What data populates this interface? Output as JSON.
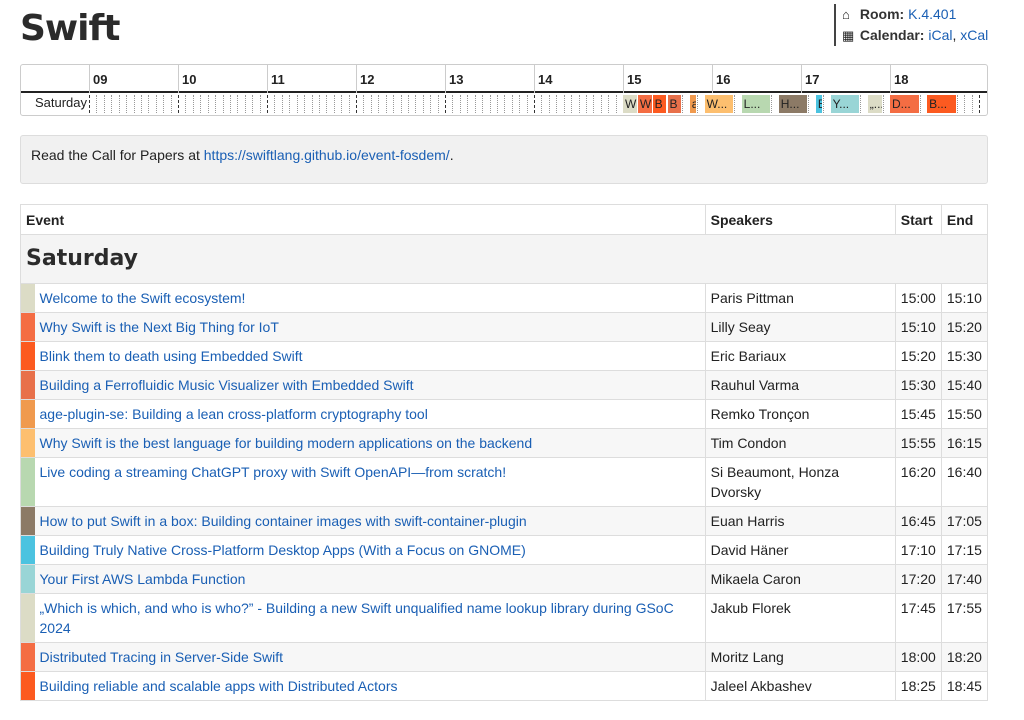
{
  "title": "Swift",
  "meta": {
    "room_label": "Room:",
    "room_value": "K.4.401",
    "calendar_label": "Calendar:",
    "ical": "iCal",
    "xcal": "xCal",
    "separator": ","
  },
  "timeline": {
    "day": "Saturday",
    "hours": [
      "09",
      "10",
      "11",
      "12",
      "13",
      "14",
      "15",
      "16",
      "17",
      "18"
    ],
    "blocks": [
      {
        "label": "W",
        "color": "#dcdcc6",
        "start": "15:00",
        "end": "15:10"
      },
      {
        "label": "W",
        "color": "#f46d43",
        "start": "15:10",
        "end": "15:20"
      },
      {
        "label": "B",
        "color": "#fc5a20",
        "start": "15:20",
        "end": "15:30"
      },
      {
        "label": "B",
        "color": "#e8704a",
        "start": "15:30",
        "end": "15:40"
      },
      {
        "label": "a",
        "color": "#f09a4e",
        "start": "15:45",
        "end": "15:50"
      },
      {
        "label": "W...",
        "color": "#fdbf6f",
        "start": "15:55",
        "end": "16:15"
      },
      {
        "label": "L...",
        "color": "#b8d8b0",
        "start": "16:20",
        "end": "16:40"
      },
      {
        "label": "H...",
        "color": "#8c7a66",
        "start": "16:45",
        "end": "17:05"
      },
      {
        "label": "B",
        "color": "#4cc3e0",
        "start": "17:10",
        "end": "17:15"
      },
      {
        "label": "Y...",
        "color": "#99d5d6",
        "start": "17:20",
        "end": "17:40"
      },
      {
        "label": "„...",
        "color": "#dcdcc6",
        "start": "17:45",
        "end": "17:55"
      },
      {
        "label": "D...",
        "color": "#f46d43",
        "start": "18:00",
        "end": "18:20"
      },
      {
        "label": "B...",
        "color": "#fc5a20",
        "start": "18:25",
        "end": "18:45"
      }
    ]
  },
  "cfp": {
    "text": "Read the Call for Papers at ",
    "link": "https://swiftlang.github.io/event-fosdem/",
    "suffix": "."
  },
  "table": {
    "headers": {
      "event": "Event",
      "speakers": "Speakers",
      "start": "Start",
      "end": "End"
    },
    "day_heading": "Saturday",
    "events": [
      {
        "title": "Welcome to the Swift ecosystem!",
        "speakers": "Paris Pittman",
        "start": "15:00",
        "end": "15:10",
        "color": "#dcdcc6"
      },
      {
        "title": "Why Swift is the Next Big Thing for IoT",
        "speakers": "Lilly Seay",
        "start": "15:10",
        "end": "15:20",
        "color": "#f46d43"
      },
      {
        "title": "Blink them to death using Embedded Swift",
        "speakers": "Eric Bariaux",
        "start": "15:20",
        "end": "15:30",
        "color": "#fc5a20"
      },
      {
        "title": "Building a Ferrofluidic Music Visualizer with Embedded Swift",
        "speakers": "Rauhul Varma",
        "start": "15:30",
        "end": "15:40",
        "color": "#e8704a"
      },
      {
        "title": "age-plugin-se: Building a lean cross-platform cryptography tool",
        "speakers": "Remko Tronçon",
        "start": "15:45",
        "end": "15:50",
        "color": "#f09a4e"
      },
      {
        "title": "Why Swift is the best language for building modern applications on the backend",
        "speakers": "Tim Condon",
        "start": "15:55",
        "end": "16:15",
        "color": "#fdbf6f"
      },
      {
        "title": "Live coding a streaming ChatGPT proxy with Swift OpenAPI—from scratch!",
        "speakers": "Si Beaumont, Honza Dvorsky",
        "start": "16:20",
        "end": "16:40",
        "color": "#b8d8b0"
      },
      {
        "title": "How to put Swift in a box: Building container images with swift-container-plugin",
        "speakers": "Euan Harris",
        "start": "16:45",
        "end": "17:05",
        "color": "#8c7a66"
      },
      {
        "title": "Building Truly Native Cross-Platform Desktop Apps (With a Focus on GNOME)",
        "speakers": "David Häner",
        "start": "17:10",
        "end": "17:15",
        "color": "#4cc3e0"
      },
      {
        "title": "Your First AWS Lambda Function",
        "speakers": "Mikaela Caron",
        "start": "17:20",
        "end": "17:40",
        "color": "#99d5d6"
      },
      {
        "title": "„Which is which, and who is who?” - Building a new Swift unqualified name lookup library during GSoC 2024",
        "speakers": "Jakub Florek",
        "start": "17:45",
        "end": "17:55",
        "color": "#dcdcc6"
      },
      {
        "title": "Distributed Tracing in Server-Side Swift",
        "speakers": "Moritz Lang",
        "start": "18:00",
        "end": "18:20",
        "color": "#f46d43"
      },
      {
        "title": "Building reliable and scalable apps with Distributed Actors",
        "speakers": "Jaleel Akbashev",
        "start": "18:25",
        "end": "18:45",
        "color": "#fc5a20"
      }
    ]
  }
}
